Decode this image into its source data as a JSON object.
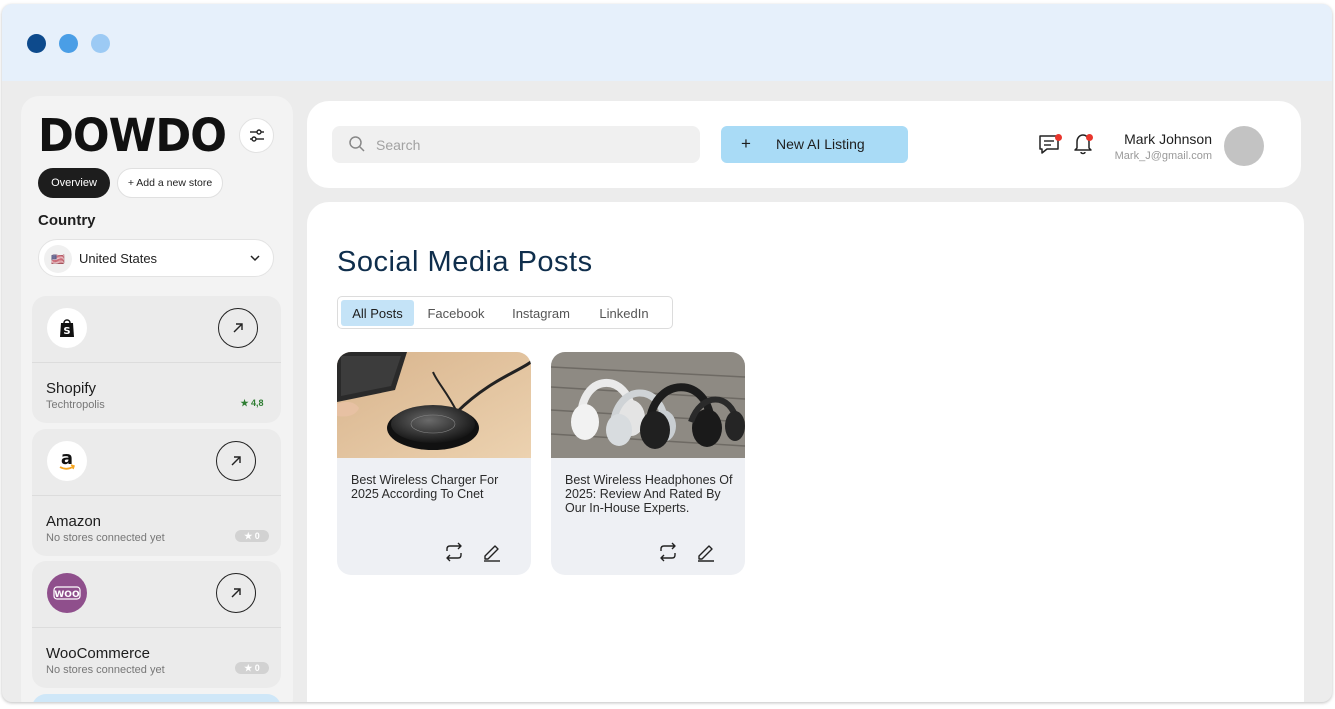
{
  "window": {
    "traffic_lights": [
      "#0d4a8c",
      "#4a9ee6",
      "#9ccaf4"
    ]
  },
  "sidebar": {
    "logo_text": "DOWDO",
    "filter_icon": "sliders-icon",
    "overview_label": "Overview",
    "add_store_label": "+ Add a new store",
    "country_label": "Country",
    "country_value": "United States",
    "country_flag": "🇺🇸",
    "stores": [
      {
        "name": "Shopify",
        "subtitle": "Techtropolis",
        "rating": "★ 4,8",
        "icon": "shopify-icon"
      },
      {
        "name": "Amazon",
        "subtitle": "No stores connected yet",
        "rating": "★ 0",
        "icon": "amazon-icon"
      },
      {
        "name": "WooCommerce",
        "subtitle": "No stores connected yet",
        "rating": "★ 0",
        "icon": "woocommerce-icon"
      }
    ]
  },
  "header": {
    "search_placeholder": "Search",
    "new_listing_plus": "+",
    "new_listing_label": "New AI Listing",
    "user_name": "Mark Johnson",
    "user_email": "Mark_J@gmail.com"
  },
  "main": {
    "title": "Social Media Posts",
    "tabs": [
      "All Posts",
      "Facebook",
      "Instagram",
      "LinkedIn"
    ],
    "active_tab": "All Posts",
    "posts": [
      {
        "title": "Best Wireless Charger For 2025 According To Cnet",
        "image": "wireless-charger-photo"
      },
      {
        "title": "Best Wireless Headphones Of 2025: Review And Rated By Our In-House Experts.",
        "image": "headphones-photo"
      }
    ]
  },
  "colors": {
    "accent": "#a9dbf6",
    "title": "#0f2e4c",
    "notification": "#e8362d"
  }
}
